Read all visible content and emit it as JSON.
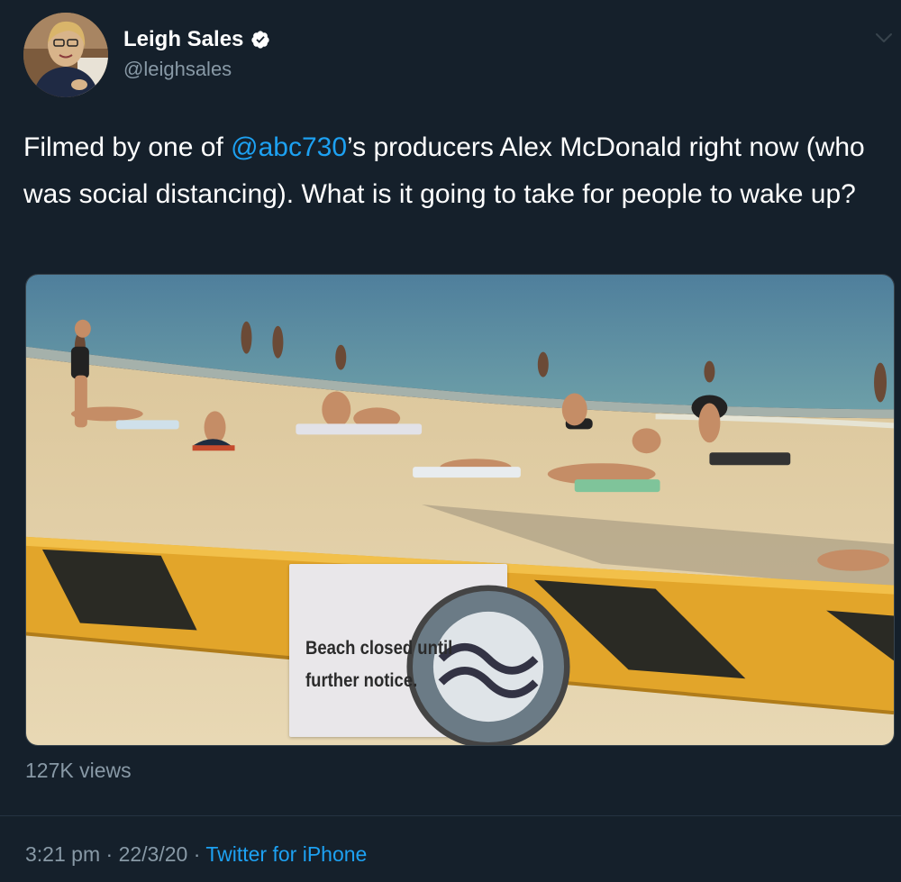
{
  "author": {
    "display_name": "Leigh Sales",
    "handle": "@leighsales",
    "verified": true
  },
  "icons": {
    "verified": "verified-badge-icon",
    "menu": "chevron-down-icon",
    "sign_emblem": "council-emblem-icon"
  },
  "tweet": {
    "text_before": "Filmed by one of ",
    "mention": "@abc730",
    "text_after": "’s producers Alex McDonald right now (who was social distancing).  What is it going to take for people to wake up?"
  },
  "media": {
    "sign_text": "Beach closed until\nfurther notice."
  },
  "stats": {
    "views": "127K views"
  },
  "meta": {
    "time": "3:21 pm",
    "separator": "·",
    "date": "22/3/20",
    "source": "Twitter for iPhone"
  },
  "colors": {
    "background": "#15202b",
    "accent": "#1da1f2",
    "secondary_text": "#8899a6"
  }
}
